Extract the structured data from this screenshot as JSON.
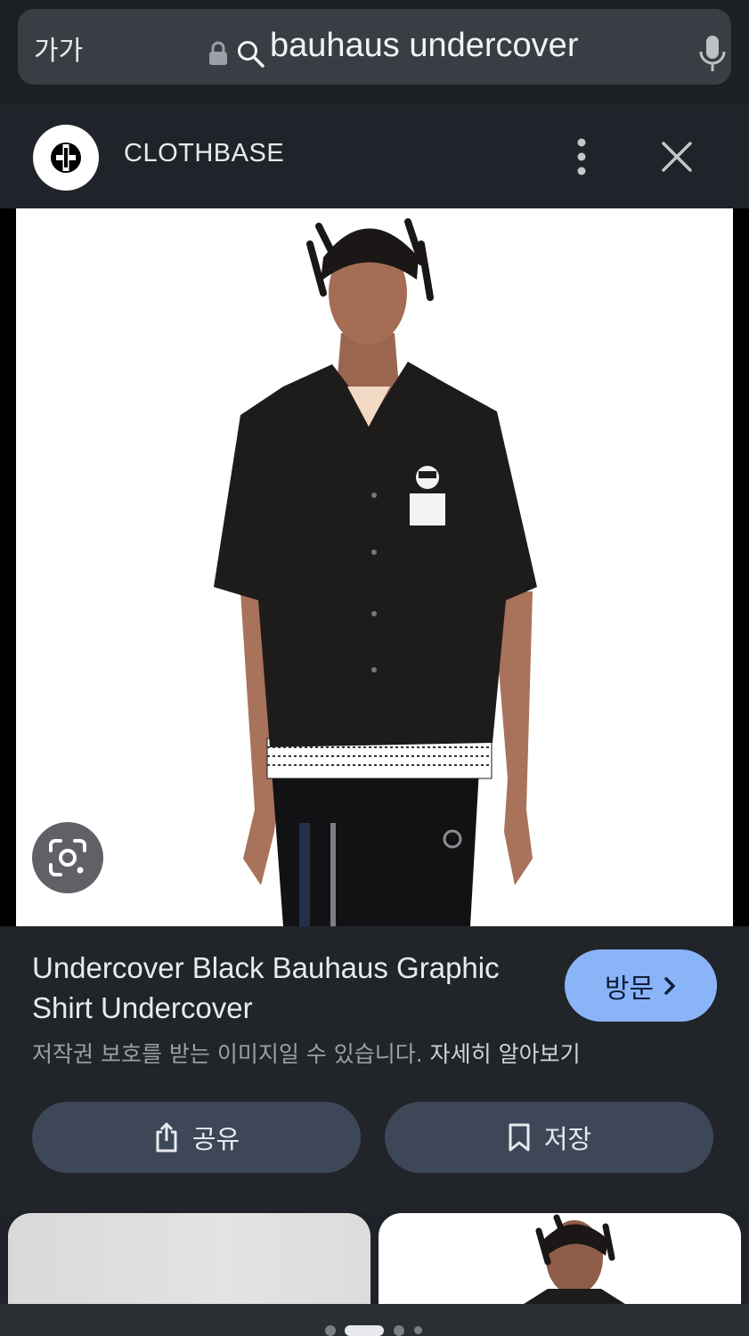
{
  "address_bar": {
    "text_size_label": "가가",
    "query": "bauhaus undercover"
  },
  "source": {
    "name": "CLOTHBASE"
  },
  "result": {
    "title": "Undercover Black Bauhaus Graphic Shirt Undercover",
    "visit_label": "방문",
    "copyright_notice": "저작권 보호를 받는 이미지일 수 있습니다.",
    "learn_more": "자세히 알아보기",
    "share_label": "공유",
    "save_label": "저장"
  },
  "colors": {
    "accent": "#8ab4f8",
    "button_bg": "#3d4757",
    "panel_bg": "#212429"
  },
  "pager": {
    "active_index": 1,
    "count": 4
  }
}
